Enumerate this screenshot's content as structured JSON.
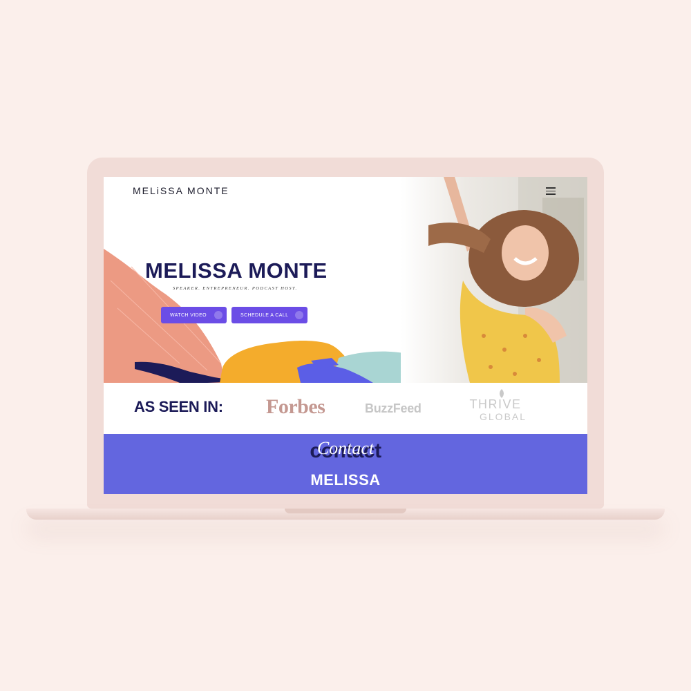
{
  "colors": {
    "background": "#fbefeb",
    "laptop": "#f1dcd7",
    "navy": "#1c1b58",
    "purple_button": "#6b4de6",
    "contact_band": "#6366df",
    "forbes": "#c49891",
    "salmon": "#ec9a83",
    "mustard": "#f4ac2c",
    "teal": "#a9d5d3"
  },
  "header": {
    "logo": "MELiSSA MONTE",
    "menu_icon": "hamburger-menu-icon"
  },
  "hero": {
    "title": "MELISSA MONTE",
    "subtitle": "SPEAKER. ENTREPRENEUR. PODCAST HOST.",
    "buttons": [
      {
        "label": "WATCH VIDEO",
        "icon": "play-icon"
      },
      {
        "label": "SCHEDULE A CALL",
        "icon": "calendar-icon"
      }
    ]
  },
  "press": {
    "label": "AS SEEN IN:",
    "logos": [
      "Forbes",
      "BuzzFeed",
      "THRIVE",
      "GLOBAL"
    ]
  },
  "contact": {
    "big": "contact",
    "script": "Contact",
    "name": "MELISSA"
  }
}
